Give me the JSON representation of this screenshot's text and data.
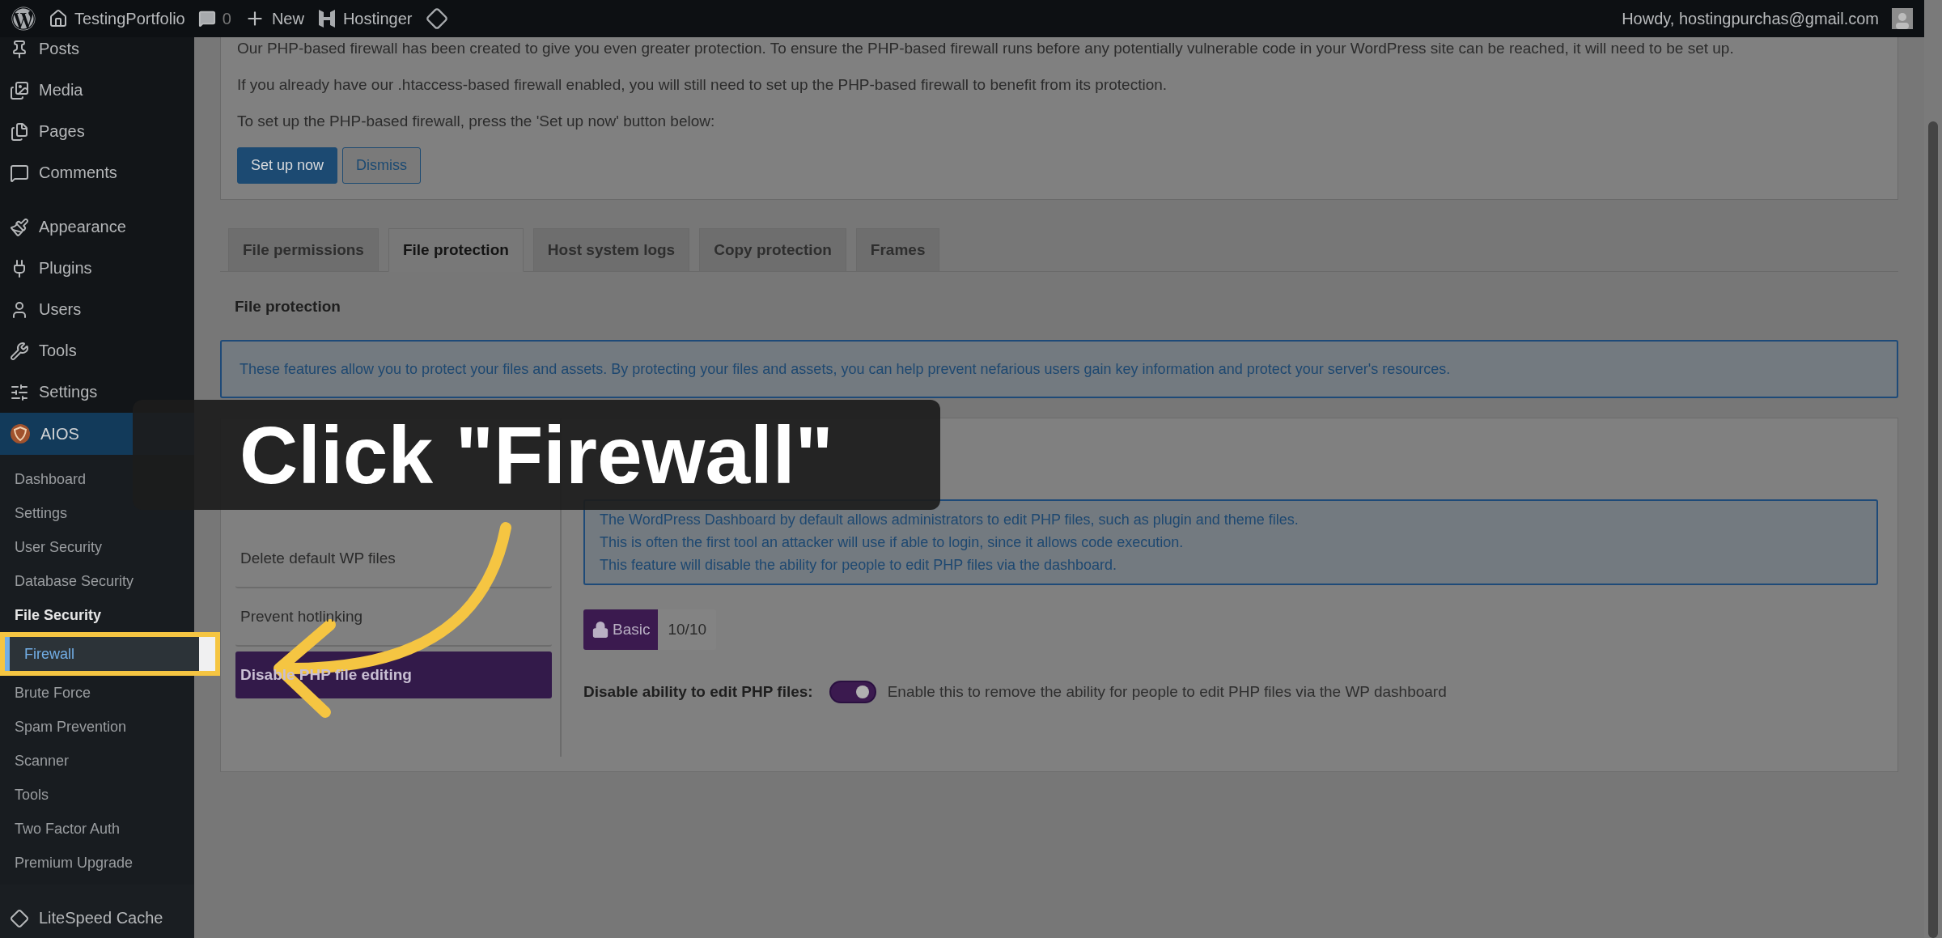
{
  "topbar": {
    "site": "TestingPortfolio",
    "comments": "0",
    "new": "New",
    "hosting": "Hostinger",
    "greeting": "Howdy, hostingpurchas@gmail.com"
  },
  "admin_menu": {
    "groups": [
      [
        {
          "label": "Posts",
          "selected": false
        },
        {
          "label": "Media",
          "selected": false
        },
        {
          "label": "Pages",
          "selected": false
        },
        {
          "label": "Comments",
          "selected": false
        }
      ],
      [
        {
          "label": "Appearance",
          "selected": false
        },
        {
          "label": "Plugins",
          "selected": false
        },
        {
          "label": "Users",
          "selected": false
        },
        {
          "label": "Tools",
          "selected": false
        },
        {
          "label": "Settings",
          "selected": false
        },
        {
          "label": "AIOS",
          "selected": true,
          "children": [
            {
              "label": "Dashboard",
              "selected": false,
              "hovered": false
            },
            {
              "label": "Settings",
              "selected": false,
              "hovered": false
            },
            {
              "label": "User Security",
              "selected": false,
              "hovered": false
            },
            {
              "label": "Database Security",
              "selected": false,
              "hovered": false
            },
            {
              "label": "File Security",
              "selected": true,
              "hovered": false
            },
            {
              "label": "Firewall",
              "selected": false,
              "hovered": true
            },
            {
              "label": "Brute Force",
              "selected": false,
              "hovered": false
            },
            {
              "label": "Spam Prevention",
              "selected": false,
              "hovered": false
            },
            {
              "label": "Scanner",
              "selected": false,
              "hovered": false
            },
            {
              "label": "Tools",
              "selected": false,
              "hovered": false
            },
            {
              "label": "Two Factor Auth",
              "selected": false,
              "hovered": false
            },
            {
              "label": "Premium Upgrade",
              "selected": false,
              "hovered": false
            }
          ]
        }
      ],
      [
        {
          "label": "LiteSpeed Cache",
          "selected": false
        }
      ]
    ]
  },
  "notice": {
    "paragraphs": [
      "Our PHP-based firewall has been created to give you even greater protection. To ensure the PHP-based firewall runs before any potentially vulnerable code in your WordPress site can be reached, it will need to be set up.",
      "If you already have our .htaccess-based firewall enabled, you will still need to set up the PHP-based firewall to benefit from its protection.",
      "To set up the PHP-based firewall, press the 'Set up now' button below:"
    ],
    "buttons": [
      {
        "label": "Set up now",
        "kind": "primary"
      },
      {
        "label": "Dismiss",
        "kind": "secondary"
      }
    ]
  },
  "tabs": [
    {
      "label": "File permissions",
      "selected": false
    },
    {
      "label": "File protection",
      "selected": true
    },
    {
      "label": "Host system logs",
      "selected": false
    },
    {
      "label": "Copy protection",
      "selected": false
    },
    {
      "label": "Frames",
      "selected": false
    }
  ],
  "section_title": "File protection",
  "intro": "These features allow you to protect your files and assets. By protecting your files and assets, you can help prevent nefarious users gain key information and protect your server's resources.",
  "features": [
    {
      "label": "Delete default WP files",
      "selected": false
    },
    {
      "label": "Prevent hotlinking",
      "selected": false
    },
    {
      "label": "Disable PHP file editing",
      "selected": true
    }
  ],
  "feature_detail": {
    "description": [
      "The WordPress Dashboard by default allows administrators to edit PHP files, such as plugin and theme files.",
      "This is often the first tool an attacker will use if able to login, since it allows code execution.",
      "This feature will disable the ability for people to edit PHP files via the dashboard."
    ],
    "badge": {
      "level": "Basic",
      "score": "10/10"
    },
    "setting": {
      "label": "Disable ability to edit PHP files:",
      "on": true,
      "hint": "Enable this to remove the ability for people to edit PHP files via the WP dashboard"
    }
  },
  "callout": {
    "text": "Click \"Firewall\""
  }
}
